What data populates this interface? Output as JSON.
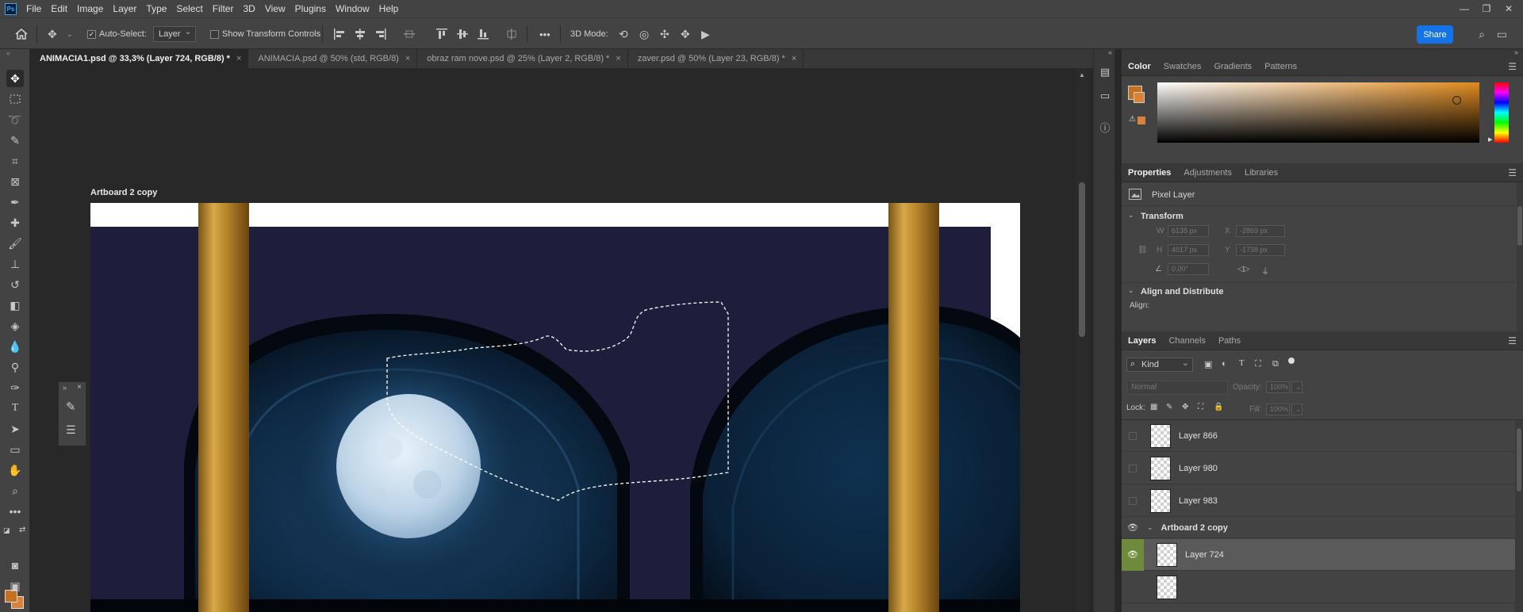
{
  "app": {
    "logo": "Ps"
  },
  "menu": [
    "File",
    "Edit",
    "Image",
    "Layer",
    "Type",
    "Select",
    "Filter",
    "3D",
    "View",
    "Plugins",
    "Window",
    "Help"
  ],
  "window_controls": {
    "minimize": "—",
    "restore": "❐",
    "close": "✕"
  },
  "options": {
    "auto_select_label": "Auto-Select:",
    "auto_select_checked": true,
    "auto_select_target": "Layer",
    "show_transform_label": "Show Transform Controls",
    "show_transform_checked": false,
    "mode_3d_label": "3D Mode:",
    "more": "•••",
    "share_label": "Share"
  },
  "tabs": [
    {
      "label": "ANIMACIA1.psd @ 33,3% (Layer 724, RGB/8) *",
      "active": true
    },
    {
      "label": "ANIMACIA.psd @ 50% (std, RGB/8)",
      "active": false
    },
    {
      "label": "obraz ram nove.psd @ 25% (Layer 2, RGB/8) *",
      "active": false
    },
    {
      "label": "zaver.psd @ 50% (Layer 23, RGB/8) *",
      "active": false
    }
  ],
  "canvas": {
    "artboard_name": "Artboard 2 copy"
  },
  "colors": {
    "foreground": "#c4701c",
    "background": "#d9823a",
    "accent": "#1473e6",
    "night_sky": "#1e1e3c",
    "gold": "#b8862a"
  },
  "color_panel": {
    "tabs": [
      "Color",
      "Swatches",
      "Gradients",
      "Patterns"
    ]
  },
  "properties_panel": {
    "tabs": [
      "Properties",
      "Adjustments",
      "Libraries"
    ],
    "layer_type": "Pixel Layer",
    "transform_title": "Transform",
    "w_label": "W",
    "w_value": "6138 px",
    "x_label": "X",
    "x_value": "-2869 px",
    "h_label": "H",
    "h_value": "4017 px",
    "y_label": "Y",
    "y_value": "-1738 px",
    "angle_value": "0,00°",
    "align_title": "Align and Distribute",
    "align_label": "Align:"
  },
  "layers_panel": {
    "tabs": [
      "Layers",
      "Channels",
      "Paths"
    ],
    "filter_kind": "Kind",
    "blend_mode": "Normal",
    "opacity_label": "Opacity:",
    "opacity_value": "100%",
    "lock_label": "Lock:",
    "fill_label": "Fill:",
    "fill_value": "100%",
    "layers": [
      {
        "name": "Layer 866",
        "visible": false
      },
      {
        "name": "Layer 980",
        "visible": false
      },
      {
        "name": "Layer 983",
        "visible": false
      }
    ],
    "group": {
      "name": "Artboard 2 copy",
      "visible": true
    },
    "selected_layer": {
      "name": "Layer 724",
      "visible": true
    }
  }
}
